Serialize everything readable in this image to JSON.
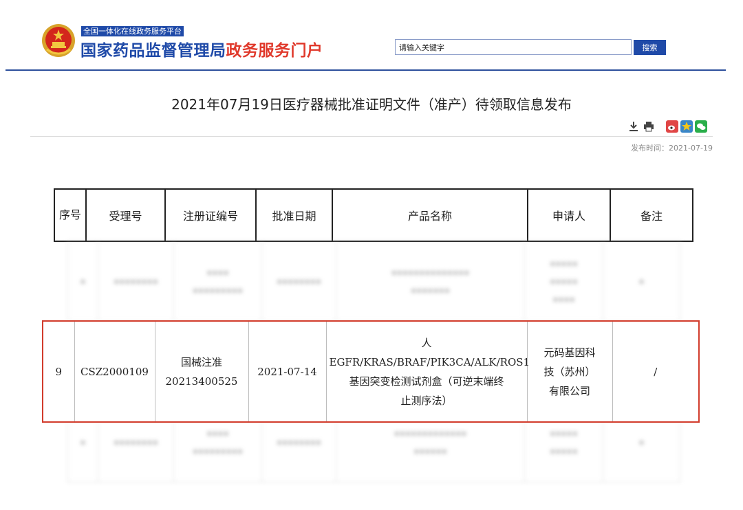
{
  "header": {
    "tag": "全国一体化在线政务服务平台",
    "title_part1": "国家药品监督管理局",
    "title_part2": "政务服务门户",
    "search": {
      "placeholder": "请输入关键字",
      "value": "请输入关键字",
      "button_label": "搜索"
    }
  },
  "article": {
    "title": "2021年07月19日医疗器械批准证明文件（准产）待领取信息发布",
    "publish_time": "发布时间：2021-07-19",
    "tools": [
      "download-icon",
      "print-icon",
      "weibo-icon",
      "qzone-icon",
      "wechat-icon"
    ]
  },
  "table": {
    "headers": [
      "序号",
      "受理号",
      "注册证编号",
      "批准日期",
      "产品名称",
      "申请人",
      "备注"
    ],
    "highlighted_row": {
      "index": "9",
      "accept_no": "CSZ2000109",
      "cert_no_line1": "国械注准",
      "cert_no_line2": "20213400525",
      "date": "2021-07-14",
      "product_line1": "人",
      "product_line2": "EGFR/KRAS/BRAF/PIK3CA/ALK/ROS1",
      "product_line3": "基因突变检测试剂盒（可逆末端终",
      "product_line4": "止测序法）",
      "applicant_line1": "元码基因科",
      "applicant_line2": "技（苏州）",
      "applicant_line3": "有限公司",
      "note": "/"
    }
  },
  "colors": {
    "brand_blue": "#1f4aa8",
    "brand_red": "#e0392b",
    "highlight_border": "#d23c2c"
  }
}
